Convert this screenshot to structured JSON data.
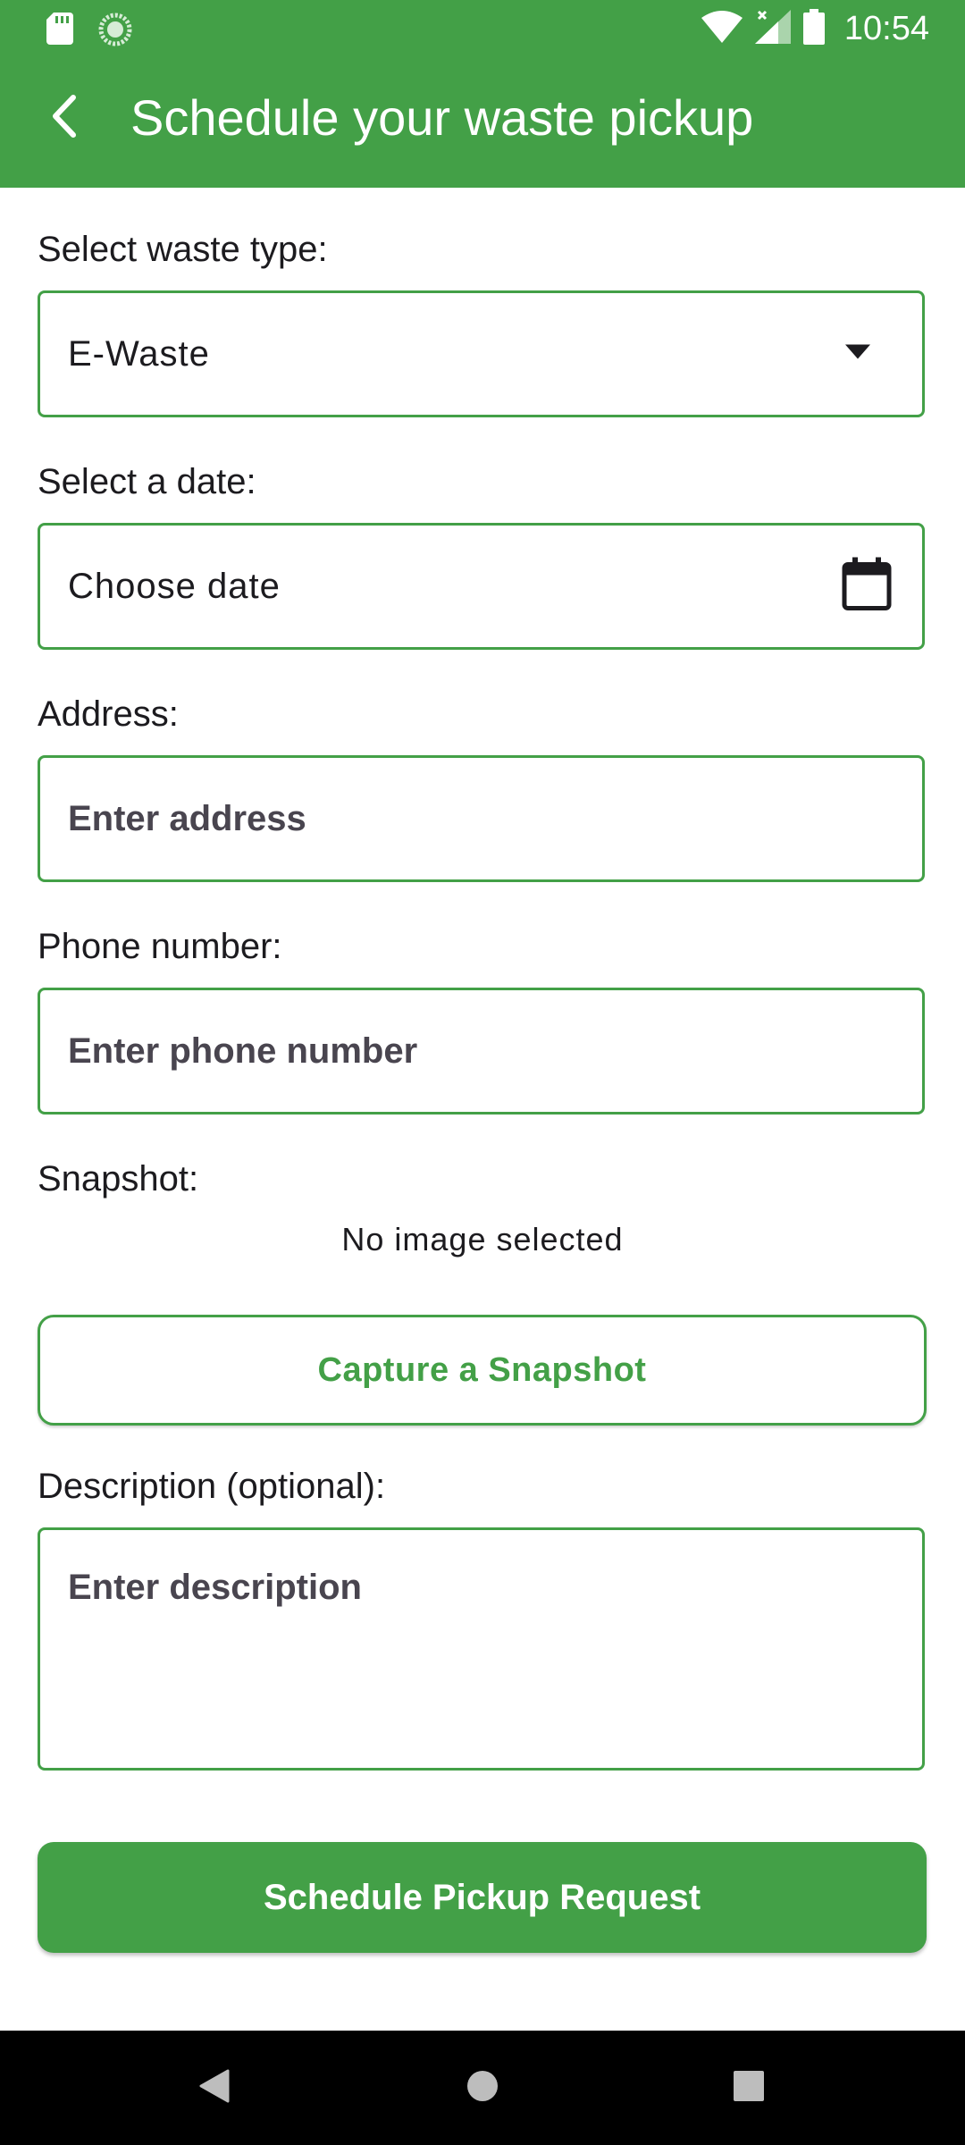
{
  "status_bar": {
    "time": "10:54",
    "icons": [
      "sd-card-icon",
      "loading-icon",
      "wifi-icon",
      "signal-icon",
      "battery-icon"
    ]
  },
  "app_bar": {
    "title": "Schedule your waste pickup",
    "back_icon": "chevron-left-icon",
    "color": "#43a047"
  },
  "form": {
    "waste_type": {
      "label": "Select waste type:",
      "value": "E-Waste",
      "icon": "dropdown-arrow-icon"
    },
    "date": {
      "label": "Select a date:",
      "value": "Choose date",
      "icon": "calendar-icon"
    },
    "address": {
      "label": "Address:",
      "placeholder": "Enter address"
    },
    "phone": {
      "label": "Phone number:",
      "placeholder": "Enter phone number"
    },
    "snapshot": {
      "label": "Snapshot:",
      "status": "No image selected",
      "button_label": "Capture a Snapshot"
    },
    "description": {
      "label": "Description (optional):",
      "placeholder": "Enter description"
    },
    "submit_label": "Schedule Pickup Request"
  },
  "nav_bar": {
    "icons": [
      "back-triangle-icon",
      "home-circle-icon",
      "recents-square-icon"
    ]
  },
  "colors": {
    "accent": "#43a047",
    "text": "#1c1b1f",
    "placeholder": "#49454f"
  }
}
